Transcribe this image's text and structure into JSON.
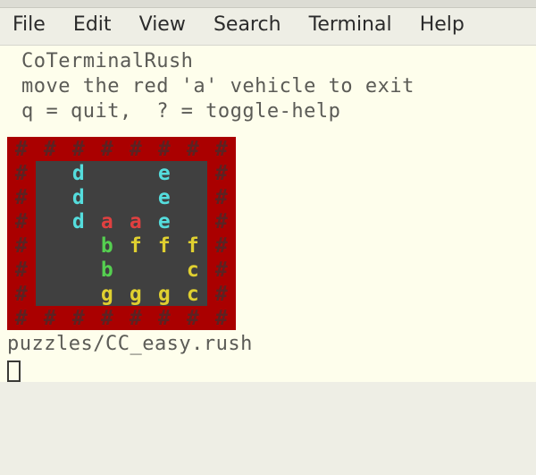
{
  "menubar": {
    "file": "File",
    "edit": "Edit",
    "view": "View",
    "search": "Search",
    "terminal": "Terminal",
    "help": "Help"
  },
  "header": {
    "title": "CoTerminalRush",
    "instruction": "move the red 'a' vehicle to exit",
    "keys": "q = quit,  ? = toggle-help"
  },
  "path": "puzzles/CC_easy.rush",
  "board_legend": {
    "wall_char": "#",
    "colors": {
      "a": "red",
      "b": "green",
      "c": "yellow",
      "d": "cyan",
      "e": "cyan",
      "f": "yellow",
      "g": "yellow"
    }
  },
  "board": [
    "########",
    "#.d..e.#",
    "#.d..e.#",
    "#.daae.#",
    "#..bfff#",
    "#..b..c#",
    "#..gggc#",
    "########"
  ]
}
